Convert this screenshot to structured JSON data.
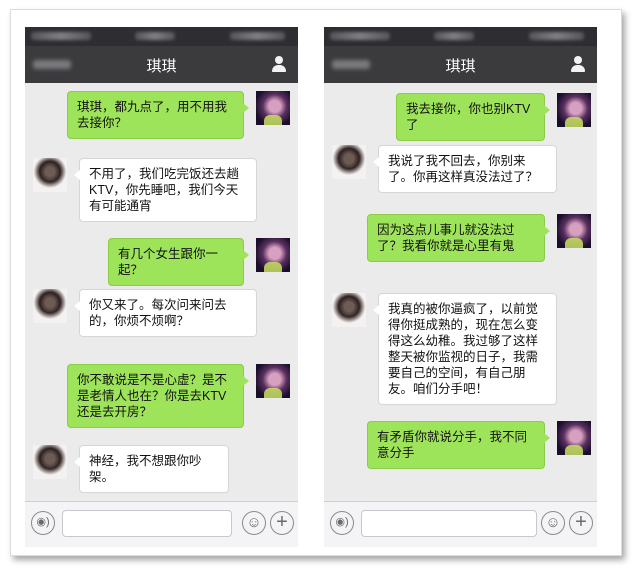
{
  "left_panel": {
    "title": "琪琪",
    "messages": [
      {
        "from": "me",
        "text": "琪琪，都九点了，用不用我去接你？"
      },
      {
        "from": "her",
        "text": "不用了，我们吃完饭还去趟KTV，你先睡吧，我们今天有可能通宵"
      },
      {
        "from": "me",
        "text": "有几个女生跟你一起？"
      },
      {
        "from": "her",
        "text": "你又来了。每次问来问去的，你烦不烦啊？"
      },
      {
        "from": "me",
        "text": "你不敢说是不是心虚？是不是老情人也在？你是去KTV还是去开房？"
      },
      {
        "from": "her",
        "text": "神经，我不想跟你吵架。"
      }
    ]
  },
  "right_panel": {
    "title": "琪琪",
    "messages": [
      {
        "from": "me",
        "text": "我去接你，你也别KTV了"
      },
      {
        "from": "her",
        "text": "我说了我不回去，你别来了。你再这样真没法过了？"
      },
      {
        "from": "me",
        "text": "因为这点儿事儿就没法过了？我看你就是心里有鬼"
      },
      {
        "from": "her",
        "text": "我真的被你逼疯了，以前觉得你挺成熟的，现在怎么变得这么幼稚。我过够了这样整天被你监视的日子，我需要自己的空间，有自己朋友。咱们分手吧！"
      },
      {
        "from": "me",
        "text": "有矛盾你就说分手，我不同意分手"
      }
    ]
  },
  "icons": {
    "back": "back-arrow-icon",
    "profile": "person-icon",
    "voice": "voice-icon",
    "emoji": "emoji-icon",
    "more": "plus-icon"
  },
  "colors": {
    "navbar": "#3b3b3e",
    "statusbar": "#2e2e32",
    "chat_background": "#ebebeb",
    "my_bubble": "#9ee45a",
    "her_bubble": "#ffffff"
  }
}
